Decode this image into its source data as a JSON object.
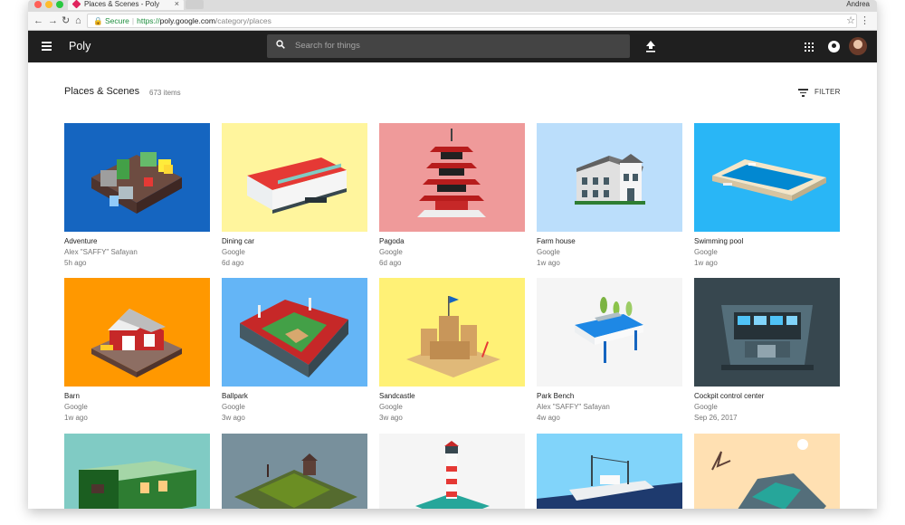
{
  "browser": {
    "tab_title": "Places & Scenes - Poly",
    "tab_close": "×",
    "user_name": "Andrea",
    "url_secure": "Secure",
    "url_scheme": "https://",
    "url_domain": "poly.google.com",
    "url_path": "/category/places",
    "colors": {
      "close": "#ff5f57",
      "minimize": "#febc2e",
      "maximize": "#28c840",
      "secure": "#1e8e3e"
    }
  },
  "appbar": {
    "brand": "Poly",
    "search_placeholder": "Search for things",
    "icons": [
      "menu-icon",
      "search-icon",
      "upload-icon",
      "apps-grid-icon",
      "account-icon"
    ]
  },
  "page": {
    "title": "Places & Scenes",
    "count": "673 items",
    "filter_label": "FILTER"
  },
  "items": [
    {
      "title": "Adventure",
      "author": "Alex \"SAFFY\" Safayan",
      "age": "5h ago",
      "bg": "#1565c0"
    },
    {
      "title": "Dining car",
      "author": "Google",
      "age": "6d ago",
      "bg": "#fff59d"
    },
    {
      "title": "Pagoda",
      "author": "Google",
      "age": "6d ago",
      "bg": "#ef9a9a"
    },
    {
      "title": "Farm house",
      "author": "Google",
      "age": "1w ago",
      "bg": "#bbdefb"
    },
    {
      "title": "Swimming pool",
      "author": "Google",
      "age": "1w ago",
      "bg": "#29b6f6"
    },
    {
      "title": "Barn",
      "author": "Google",
      "age": "1w ago",
      "bg": "#ff9800"
    },
    {
      "title": "Ballpark",
      "author": "Google",
      "age": "3w ago",
      "bg": "#64b5f6"
    },
    {
      "title": "Sandcastle",
      "author": "Google",
      "age": "3w ago",
      "bg": "#fff176"
    },
    {
      "title": "Park Bench",
      "author": "Alex \"SAFFY\" Safayan",
      "age": "4w ago",
      "bg": "#f5f5f5"
    },
    {
      "title": "Cockpit control center",
      "author": "Google",
      "age": "Sep 26, 2017",
      "bg": "#37474f"
    },
    {
      "title": "",
      "author": "",
      "age": "",
      "bg": "#80cbc4"
    },
    {
      "title": "",
      "author": "",
      "age": "",
      "bg": "#78909c"
    },
    {
      "title": "",
      "author": "",
      "age": "",
      "bg": "#f5f5f5"
    },
    {
      "title": "",
      "author": "",
      "age": "",
      "bg": "#81d4fa"
    },
    {
      "title": "",
      "author": "",
      "age": "",
      "bg": "#ffe0b2"
    }
  ]
}
